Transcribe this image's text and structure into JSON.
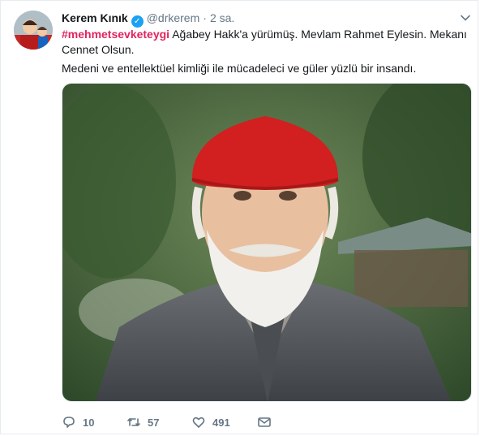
{
  "tweet": {
    "author_name": "Kerem Kınık",
    "handle": "@drkerem",
    "separator": "·",
    "time": "2 sa.",
    "hashtag": "#mehmetsevketeygi",
    "line1_rest": " Ağabey Hakk'a yürümüş. Mevlam Rahmet Eylesin. Mekanı Cennet Olsun.",
    "line2": "Medeni ve entellektüel kimliği ile mücadeleci ve güler yüzlü bir insandı."
  },
  "actions": {
    "replies": "10",
    "retweets": "57",
    "likes": "491"
  },
  "icons": {
    "verified": "verified-badge-icon",
    "menu": "chevron-down-icon",
    "reply": "reply-icon",
    "retweet": "retweet-icon",
    "like": "heart-icon",
    "dm": "envelope-icon"
  },
  "colors": {
    "hashtag": "#e0245e",
    "verified": "#1da1f2",
    "muted": "#657786"
  }
}
